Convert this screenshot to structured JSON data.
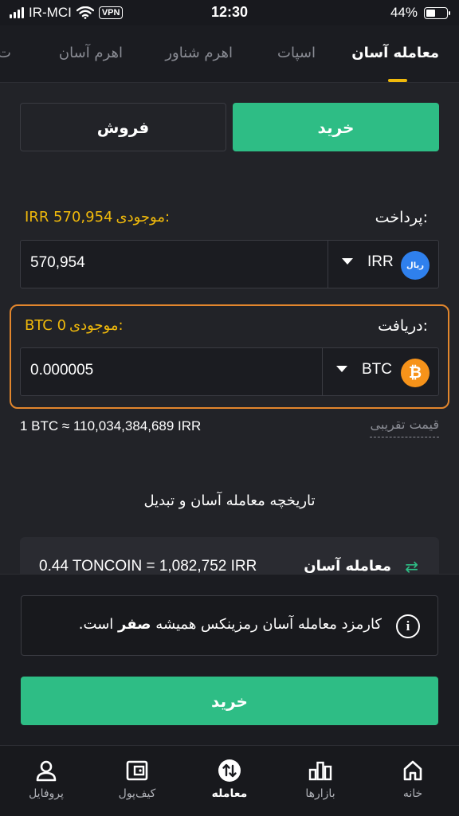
{
  "status_bar": {
    "carrier": "IR-MCI",
    "vpn": "VPN",
    "time": "12:30",
    "battery": "44%",
    "battery_level": 0.44
  },
  "tabs": [
    "معامله آسان",
    "اسپات",
    "اهرم شناور",
    "اهرم آسان",
    "ت"
  ],
  "active_tab": 0,
  "segment": {
    "buy": "خرید",
    "sell": "فروش",
    "active": "buy"
  },
  "pay": {
    "label": "پرداخت:",
    "balance_label": "موجودی:",
    "balance_value": "IRR 570,954",
    "amount": "570,954",
    "currency": "IRR",
    "coin_text": "ریال",
    "coin_icon": "rial-coin-icon"
  },
  "receive": {
    "label": "دریافت:",
    "balance_label": "موجودی:",
    "balance_value": "BTC 0",
    "amount": "0.000005",
    "currency": "BTC",
    "coin_symbol": "₿",
    "coin_icon": "bitcoin-coin-icon"
  },
  "rate": {
    "text": "1 BTC ≈ 110,034,384,689 IRR",
    "approx_label": "قیمت تقریبی"
  },
  "history": {
    "title": "تاریخچه معامله آسان و تبدیل",
    "items": [
      {
        "type": "معامله آسان",
        "text": "0.44 TONCOIN = 1,082,752 IRR"
      }
    ]
  },
  "notice": {
    "text_before": "کارمزد معامله آسان رمزینکس همیشه",
    "text_bold": "صفر",
    "text_after": "است."
  },
  "cta": {
    "label": "خرید"
  },
  "bottom_nav": [
    {
      "label": "خانه",
      "icon": "home-icon"
    },
    {
      "label": "بازارها",
      "icon": "markets-icon"
    },
    {
      "label": "معامله",
      "icon": "trade-icon",
      "active": true
    },
    {
      "label": "کیف‌پول",
      "icon": "wallet-icon"
    },
    {
      "label": "پروفایل",
      "icon": "profile-icon"
    }
  ],
  "colors": {
    "accent_green": "#2ebd85",
    "accent_yellow": "#f0b90b",
    "highlight_orange": "#e2862d",
    "background": "#1b1c21"
  }
}
